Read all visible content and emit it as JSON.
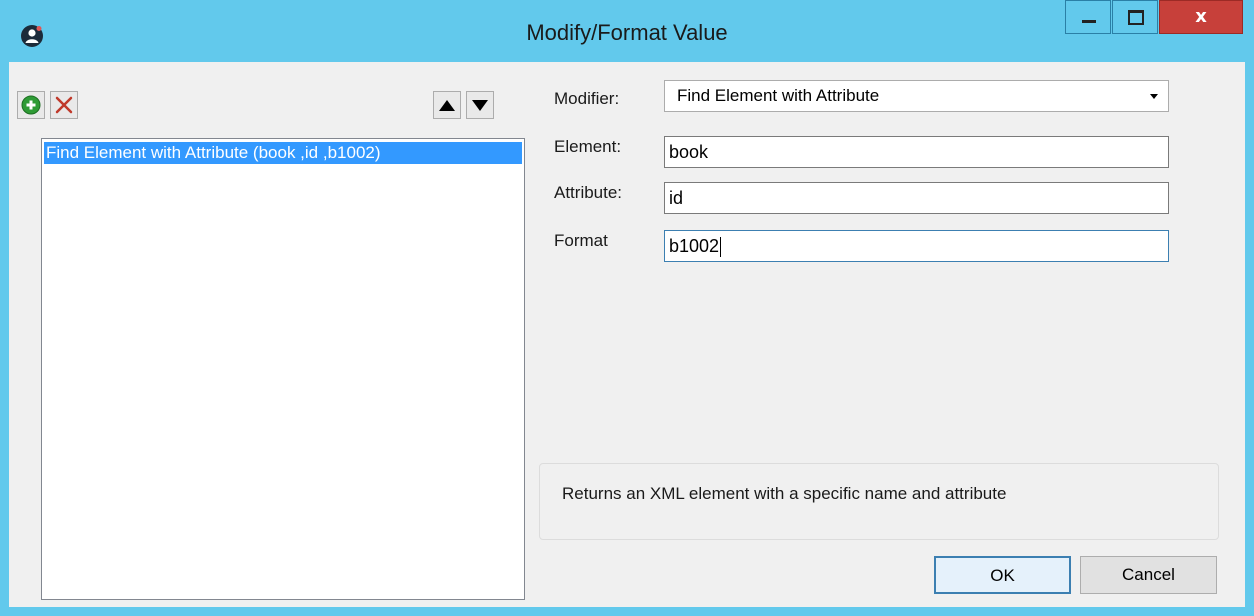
{
  "window": {
    "title": "Modify/Format Value",
    "close_glyph": "x",
    "colors": {
      "title_bar": "#62c9ec",
      "close_button": "#c7403a",
      "selection": "#3399ff"
    }
  },
  "toolbar": {
    "add_icon": "plus-circle-icon",
    "delete_icon": "red-x-icon",
    "move_up_icon": "triangle-up-icon",
    "move_down_icon": "triangle-down-icon"
  },
  "modifiers_list": {
    "items": [
      {
        "label": "Find Element with Attribute (book ,id ,b1002)",
        "selected": true
      }
    ]
  },
  "form": {
    "modifier_label": "Modifier:",
    "modifier_value": "Find Element with Attribute",
    "element_label": "Element:",
    "element_value": "book",
    "attribute_label": "Attribute:",
    "attribute_value": "id",
    "format_label": "Format",
    "format_value": "b1002"
  },
  "description": "Returns an XML element with a specific name and attribute",
  "buttons": {
    "ok": "OK",
    "cancel": "Cancel"
  }
}
